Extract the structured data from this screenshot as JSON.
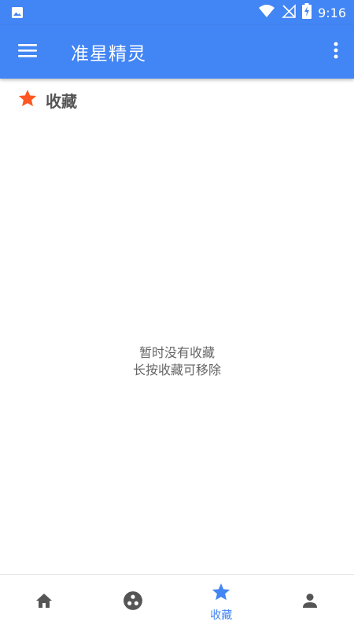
{
  "status_bar": {
    "time": "9:16"
  },
  "app_bar": {
    "title": "准星精灵"
  },
  "section": {
    "title": "收藏"
  },
  "empty_state": {
    "line1": "暂时没有收藏",
    "line2": "长按收藏可移除"
  },
  "bottom_nav": {
    "favorites_label": "收藏"
  },
  "colors": {
    "primary": "#4285f4",
    "star_accent": "#ff5722",
    "icon_gray": "#555555",
    "text_gray": "#666666"
  },
  "icons": {
    "status_left": "image-icon",
    "status_right": [
      "wifi-icon",
      "no-signal-icon",
      "battery-charging-icon"
    ],
    "app_bar_left": "menu-icon",
    "app_bar_right": "more-vert-icon",
    "section": "star-icon",
    "nav": [
      "home-icon",
      "circle-dots-icon",
      "star-icon",
      "person-icon"
    ]
  },
  "bottom_nav_selected": "favorites"
}
